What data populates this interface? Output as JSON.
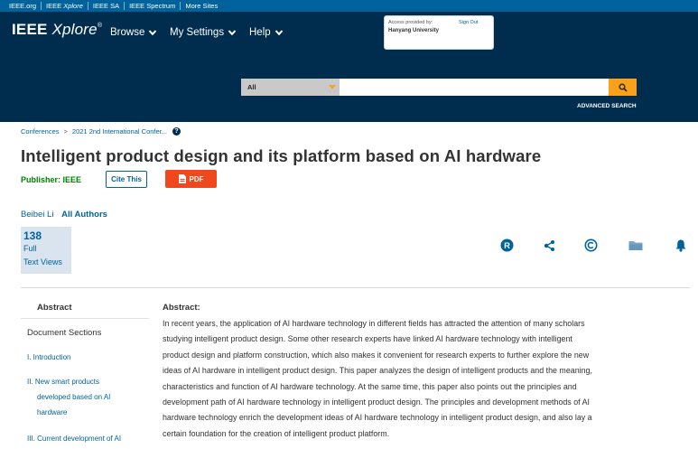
{
  "util_bar": {
    "links": [
      {
        "pre": "IEEE.org",
        "italic": "",
        "post": ""
      },
      {
        "pre": "IEEE ",
        "italic": "Xplore",
        "post": ""
      },
      {
        "pre": "IEEE SA",
        "italic": "",
        "post": ""
      },
      {
        "pre": "IEEE Spectrum",
        "italic": "",
        "post": ""
      },
      {
        "pre": "More Sites",
        "italic": "",
        "post": ""
      }
    ]
  },
  "header": {
    "logo_ieee": "IEEE",
    "logo_xplore": "Xplore",
    "logo_reg": "®",
    "nav": {
      "browse": "Browse",
      "settings": "My Settings",
      "help": "Help"
    },
    "access": {
      "label": "Access provided by:",
      "institution": "Hanyang University",
      "sign_out": "Sign Out"
    },
    "search": {
      "scope": "All",
      "placeholder": "",
      "advanced": "ADVANCED SEARCH"
    }
  },
  "breadcrumb": {
    "root": "Conferences",
    "separator": ">",
    "current": "2021 2nd International Confer..."
  },
  "article": {
    "title": "Intelligent product design and its platform based on AI hardware",
    "publisher": "Publisher: IEEE",
    "cite_label": "Cite This",
    "pdf_label": "PDF",
    "author": "Beibei Li",
    "all_authors": "All Authors",
    "metric": {
      "value": "138",
      "line1": "Full",
      "line2": "Text Views"
    }
  },
  "tools": [
    "reprints-icon",
    "share-icon",
    "copyright-icon",
    "folder-icon",
    "alert-bell-icon"
  ],
  "sidebar": {
    "abstract": "Abstract",
    "document_sections": "Document Sections",
    "items": [
      "I. Introduction",
      "II. New smart products",
      "developed based on AI",
      "hardware",
      "III. Current development of AI"
    ]
  },
  "abstract": {
    "heading": "Abstract:",
    "lines": [
      "In recent years, the application of AI hardware technology in different fields has attracted the attention of many scholars",
      "studying intelligent product design. Some other research experts have linked AI hardware technology with intelligent",
      "product design and platform construction, which also makes it convenient for research experts to further explore the new",
      "ideas of AI hardware in intelligent product design. This paper analyzes the design of intelligent products and the meaning,",
      "characteristics and function of AI hardware technology. At the same time, this paper also points out the principles and",
      "development path of AI hardware technology in intelligent product design. The principles and development methods of AI",
      "hardware technology enrich the development ideas of AI hardware technology in intelligent product design, and also lay a",
      "certain foundation for the creation of intelligent product platform."
    ]
  },
  "colors": {
    "util_bar": "#00629b",
    "header": "#002d4d",
    "link": "#00629b",
    "publisher": "#008000",
    "pdf": "#f1471d",
    "search_button": "#f9a11b",
    "metric_bg": "#d9e4ef"
  }
}
